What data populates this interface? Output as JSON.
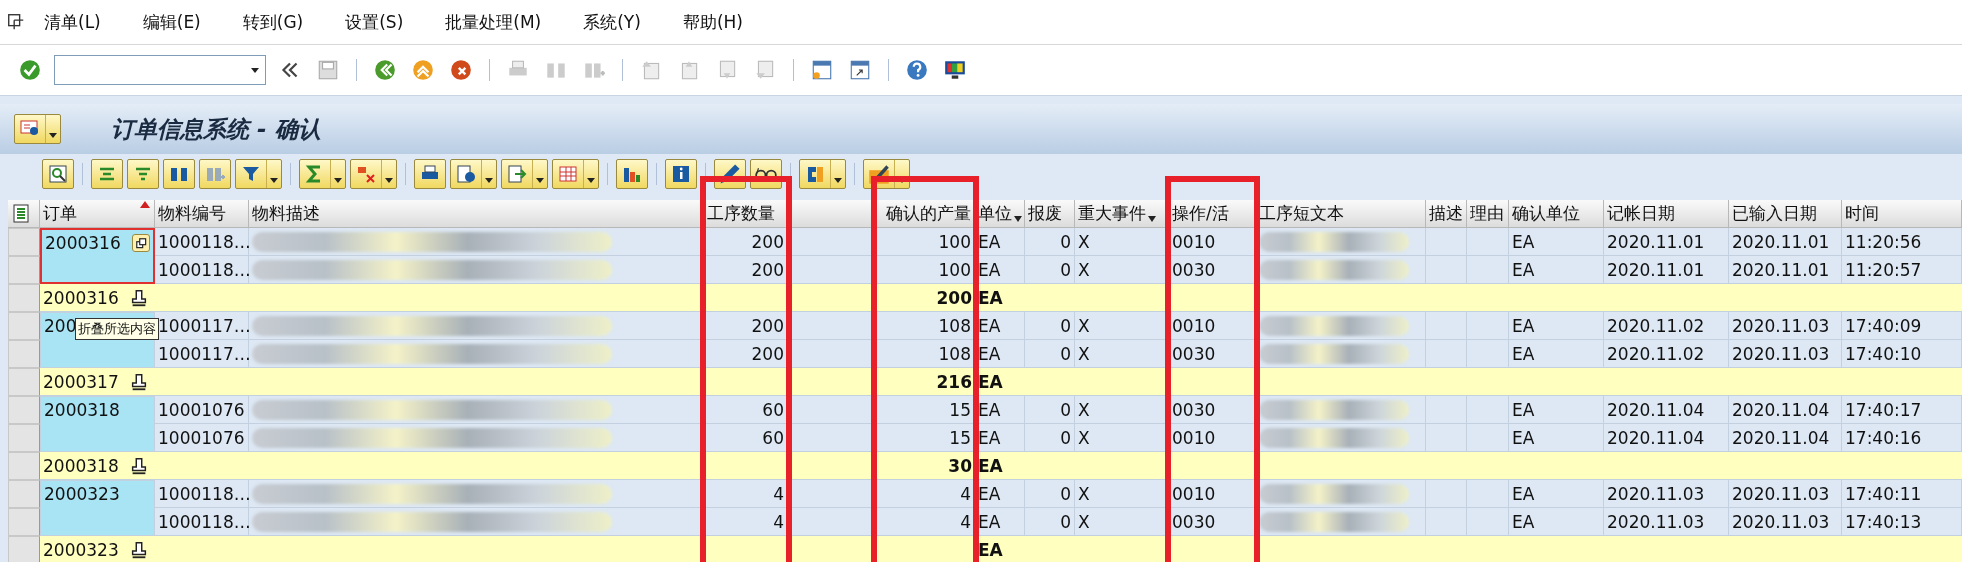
{
  "menu": [
    "清单(L)",
    "编辑(E)",
    "转到(G)",
    "设置(S)",
    "批量处理(M)",
    "系统(Y)",
    "帮助(H)"
  ],
  "title": "订单信息系统 - 确认",
  "columns": [
    {
      "label": "订单",
      "sorted": true,
      "dropdown": false,
      "highlighted": false
    },
    {
      "label": "物料编号",
      "sorted": false,
      "dropdown": false,
      "highlighted": false
    },
    {
      "label": "物料描述",
      "sorted": false,
      "dropdown": false,
      "highlighted": false
    },
    {
      "label": "工序数量",
      "sorted": false,
      "dropdown": false,
      "highlighted": true
    },
    {
      "sorted": false,
      "dropdown": false,
      "highlighted": false
    },
    {
      "label": "确认的产量",
      "sorted": false,
      "dropdown": false,
      "highlighted": true
    },
    {
      "label": "单位",
      "sorted": false,
      "dropdown": true,
      "highlighted": false
    },
    {
      "label": "报废",
      "sorted": false,
      "dropdown": false,
      "highlighted": false
    },
    {
      "label": "重大事件",
      "sorted": false,
      "dropdown": true,
      "highlighted": false
    },
    {
      "label": "操作/活",
      "sorted": false,
      "dropdown": false,
      "highlighted": true
    },
    {
      "label": "工序短文本",
      "sorted": false,
      "dropdown": false,
      "highlighted": false
    },
    {
      "label": "描述",
      "sorted": false,
      "dropdown": false,
      "highlighted": false
    },
    {
      "label": "理由",
      "sorted": false,
      "dropdown": false,
      "highlighted": false
    },
    {
      "label": "确认单位",
      "sorted": false,
      "dropdown": false,
      "highlighted": false
    },
    {
      "label": "记帐日期",
      "sorted": false,
      "dropdown": false,
      "highlighted": false
    },
    {
      "label": "已输入日期",
      "sorted": false,
      "dropdown": false,
      "highlighted": false
    },
    {
      "label": "时间",
      "sorted": false,
      "dropdown": false,
      "highlighted": false
    }
  ],
  "groups": [
    {
      "order": "2000316",
      "focused": true,
      "rows": [
        {
          "material": "1000118…",
          "quantity": "200",
          "yield": "100",
          "unit": "EA",
          "scrap": "0",
          "milestone": "X",
          "operation": "0010",
          "confirm_unit": "EA",
          "posting_date": "2020.11.01",
          "entered_date": "2020.11.01",
          "time": "11:20:56"
        },
        {
          "material": "1000118…",
          "quantity": "200",
          "yield": "100",
          "unit": "EA",
          "scrap": "0",
          "milestone": "X",
          "operation": "0030",
          "confirm_unit": "EA",
          "posting_date": "2020.11.01",
          "entered_date": "2020.11.01",
          "time": "11:20:57"
        }
      ],
      "total": {
        "order": "2000316",
        "yield": "200",
        "unit": "EA"
      }
    },
    {
      "order": "200",
      "focused": false,
      "tooltip": "折叠所选内容",
      "rows": [
        {
          "material": "1000117…",
          "quantity": "200",
          "yield": "108",
          "unit": "EA",
          "scrap": "0",
          "milestone": "X",
          "operation": "0010",
          "confirm_unit": "EA",
          "posting_date": "2020.11.02",
          "entered_date": "2020.11.03",
          "time": "17:40:09"
        },
        {
          "material": "1000117…",
          "quantity": "200",
          "yield": "108",
          "unit": "EA",
          "scrap": "0",
          "milestone": "X",
          "operation": "0030",
          "confirm_unit": "EA",
          "posting_date": "2020.11.02",
          "entered_date": "2020.11.03",
          "time": "17:40:10"
        }
      ],
      "total": {
        "order": "2000317",
        "yield": "216",
        "unit": "EA"
      }
    },
    {
      "order": "2000318",
      "focused": false,
      "rows": [
        {
          "material": "10001076",
          "quantity": "60",
          "yield": "15",
          "unit": "EA",
          "scrap": "0",
          "milestone": "X",
          "operation": "0030",
          "confirm_unit": "EA",
          "posting_date": "2020.11.04",
          "entered_date": "2020.11.04",
          "time": "17:40:17"
        },
        {
          "material": "10001076",
          "quantity": "60",
          "yield": "15",
          "unit": "EA",
          "scrap": "0",
          "milestone": "X",
          "operation": "0010",
          "confirm_unit": "EA",
          "posting_date": "2020.11.04",
          "entered_date": "2020.11.04",
          "time": "17:40:16"
        }
      ],
      "total": {
        "order": "2000318",
        "yield": "30",
        "unit": "EA"
      }
    },
    {
      "order": "2000323",
      "focused": false,
      "rows": [
        {
          "material": "1000118…",
          "quantity": "4",
          "yield": "4",
          "unit": "EA",
          "scrap": "0",
          "milestone": "X",
          "operation": "0010",
          "confirm_unit": "EA",
          "posting_date": "2020.11.03",
          "entered_date": "2020.11.03",
          "time": "17:40:11"
        },
        {
          "material": "1000118…",
          "quantity": "4",
          "yield": "4",
          "unit": "EA",
          "scrap": "0",
          "milestone": "X",
          "operation": "0030",
          "confirm_unit": "EA",
          "posting_date": "2020.11.03",
          "entered_date": "2020.11.03",
          "time": "17:40:13"
        }
      ],
      "total": {
        "order": "2000323",
        "unit": "EA"
      }
    }
  ]
}
